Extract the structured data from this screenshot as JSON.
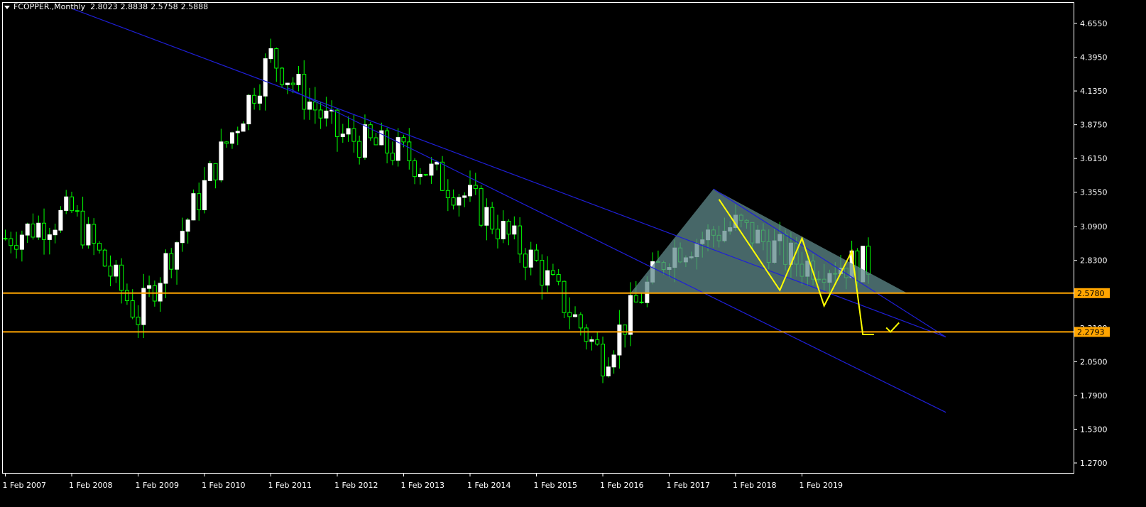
{
  "header": {
    "symbol": "FCOPPER.,Monthly",
    "open": "2.8023",
    "high": "2.8838",
    "low": "2.5758",
    "close": "2.5888"
  },
  "colors": {
    "background": "#000000",
    "frame": "#ffffff",
    "bull_candle": "#ffffff",
    "wick": "#00ff00",
    "trendline": "#1f1fd8",
    "horizontal_level": "#ffa500",
    "triangle_fill": "#5f8a8b",
    "pattern_line": "#ffff00"
  },
  "chart_data": {
    "type": "candlestick",
    "title": "FCOPPER.,Monthly",
    "timeframe": "Monthly",
    "ylim": [
      1.15,
      4.75
    ],
    "y_ticks": [
      "4.6550",
      "4.3950",
      "4.1350",
      "3.8750",
      "3.6150",
      "3.3550",
      "3.0900",
      "2.8300",
      "2.5780",
      "2.3100",
      "2.0500",
      "1.7900",
      "1.5300",
      "1.2700"
    ],
    "x_ticks": [
      "1 Feb 2007",
      "1 Feb 2008",
      "1 Feb 2009",
      "1 Feb 2010",
      "1 Feb 2011",
      "1 Feb 2012",
      "1 Feb 2013",
      "1 Feb 2014",
      "1 Feb 2015",
      "1 Feb 2016",
      "1 Feb 2017",
      "1 Feb 2018",
      "1 Feb 2019"
    ],
    "price_levels": [
      {
        "value": 2.578,
        "label": "2.5780"
      },
      {
        "value": 2.2793,
        "label": "2.2793"
      }
    ],
    "yearly_anchors": [
      3.0,
      3.2,
      2.4,
      3.4,
      4.4,
      3.8,
      3.65,
      3.3,
      2.8,
      2.08,
      2.9,
      3.1,
      2.8
    ],
    "trendlines": [
      {
        "name": "upper-trendline",
        "from": {
          "date": "2008-01",
          "price": 4.77
        },
        "to": {
          "date": "2021-03",
          "price": 2.24
        }
      },
      {
        "name": "lower-trendline",
        "from": {
          "date": "2011-04",
          "price": 4.16
        },
        "to": {
          "date": "2021-03",
          "price": 1.66
        }
      },
      {
        "name": "triangle-top-line",
        "from": {
          "date": "2017-09",
          "price": 3.38
        },
        "to": {
          "date": "2021-03",
          "price": 2.24
        }
      }
    ],
    "triangle": [
      {
        "date": "2016-06",
        "price": 2.578
      },
      {
        "date": "2017-09",
        "price": 3.38
      },
      {
        "date": "2020-08",
        "price": 2.578
      }
    ],
    "pattern": [
      {
        "date": "2017-10",
        "price": 3.3
      },
      {
        "date": "2018-09",
        "price": 2.6
      },
      {
        "date": "2019-01",
        "price": 3.0
      },
      {
        "date": "2019-05",
        "price": 2.48
      },
      {
        "date": "2019-10",
        "price": 2.9
      },
      {
        "date": "2019-12",
        "price": 2.26
      },
      {
        "date": "2020-02",
        "price": 2.26
      }
    ],
    "checkmark": {
      "date": "2020-05",
      "price": 2.29
    },
    "grid": false,
    "legend": "none"
  }
}
